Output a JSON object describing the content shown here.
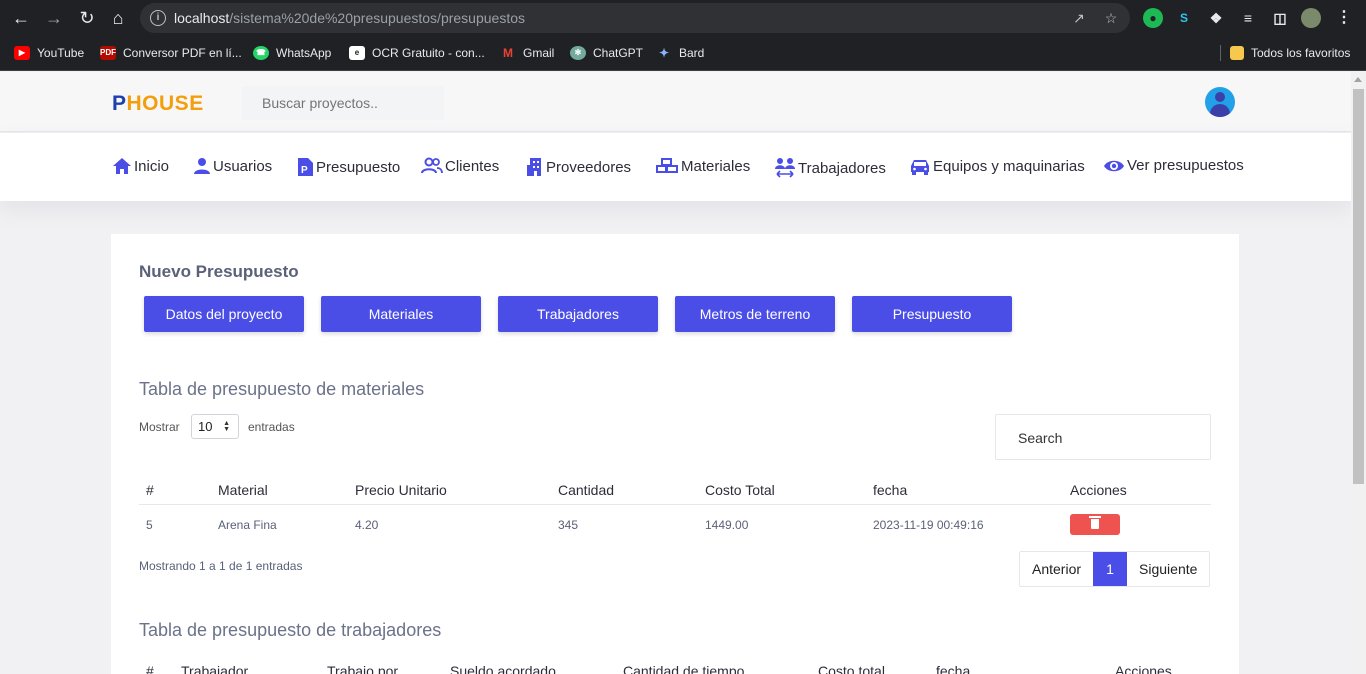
{
  "browser": {
    "url_host": "localhost",
    "url_path": "/sistema%20de%20presupuestos/presupuestos",
    "bookmarks": [
      {
        "label": "YouTube",
        "color": "#ff0000"
      },
      {
        "label": "Conversor PDF en lí...",
        "color": "#b30b00"
      },
      {
        "label": "WhatsApp",
        "color": "#25d366"
      },
      {
        "label": "OCR Gratuito - con...",
        "color": "#ffffff"
      },
      {
        "label": "Gmail",
        "color": "#ea4335"
      },
      {
        "label": "ChatGPT",
        "color": "#74aa9c"
      },
      {
        "label": "Bard",
        "color": "#8ab4f8"
      }
    ],
    "all_bookmarks": "Todos los favoritos"
  },
  "header": {
    "logo_p": "P",
    "logo_rest": "HOUSE",
    "search_placeholder": "Buscar proyectos.."
  },
  "menu": [
    {
      "label": "Inicio",
      "icon": "home-icon"
    },
    {
      "label": "Usuarios",
      "icon": "user-icon"
    },
    {
      "label": "Presupuesto",
      "icon": "file-p-icon"
    },
    {
      "label": "Clientes",
      "icon": "users-icon"
    },
    {
      "label": "Proveedores",
      "icon": "building-icon"
    },
    {
      "label": "Materiales",
      "icon": "blocks-icon"
    },
    {
      "label": "Trabajadores",
      "icon": "workers-icon"
    },
    {
      "label": "Equipos y maquinarias",
      "icon": "car-icon"
    },
    {
      "label": "Ver presupuestos",
      "icon": "eye-icon"
    }
  ],
  "main": {
    "title": "Nuevo Presupuesto",
    "steps": [
      "Datos del proyecto",
      "Materiales",
      "Trabajadores",
      "Metros de terreno",
      "Presupuesto"
    ],
    "materials_table": {
      "title": "Tabla de presupuesto de materiales",
      "show_label": "Mostrar",
      "entries_value": "10",
      "entries_label": "entradas",
      "search_placeholder": "Search",
      "columns": [
        "#",
        "Material",
        "Precio Unitario",
        "Cantidad",
        "Costo Total",
        "fecha",
        "Acciones"
      ],
      "rows": [
        {
          "id": "5",
          "material": "Arena Fina",
          "precio": "4.20",
          "cantidad": "345",
          "costo": "1449.00",
          "fecha": "2023-11-19 00:49:16"
        }
      ],
      "info": "Mostrando 1 a 1 de 1 entradas",
      "prev": "Anterior",
      "page": "1",
      "next": "Siguiente"
    },
    "workers_table": {
      "title": "Tabla de presupuesto de trabajadores",
      "columns": [
        "#",
        "Trabajador",
        "Trabajo por",
        "Sueldo acordado",
        "Cantidad de tiempo",
        "Costo total",
        "fecha",
        "Acciones"
      ]
    }
  },
  "colors": {
    "accent": "#4a4de6",
    "logo_blue": "#1e40af",
    "logo_orange": "#f59e0b",
    "danger": "#ef5350"
  }
}
